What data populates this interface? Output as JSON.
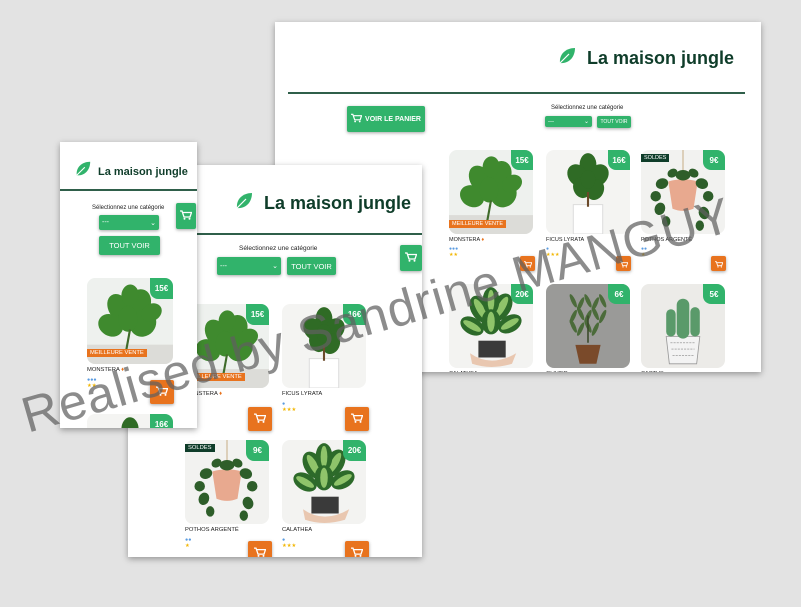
{
  "app": {
    "title": "La maison jungle"
  },
  "colors": {
    "green": "#31b36b",
    "dark_green": "#0f3d2a",
    "orange": "#e8731e",
    "background": "#e3e3e3"
  },
  "icons": {
    "logo": "leaf-icon",
    "cart": "cart-icon",
    "water": "water-drop-icon",
    "sun": "sun-icon",
    "fire": "fire-icon"
  },
  "filters": {
    "category_label": "Sélectionnez une catégorie",
    "select_value": "---",
    "show_all": "TOUT VOIR"
  },
  "cart_button_label": "VOIR LE PANIER",
  "labels": {
    "best_seller": "MEILLEURE VENTE",
    "sale": "SOLDES"
  },
  "plants": [
    {
      "name": "MONSTERA",
      "price": "15€",
      "water": 3,
      "light": 2,
      "best": true,
      "sale": false
    },
    {
      "name": "FICUS LYRATA",
      "price": "16€",
      "water": 1,
      "light": 3,
      "best": false,
      "sale": false
    },
    {
      "name": "POTHOS ARGENTÉ",
      "price": "9€",
      "water": 2,
      "light": 1,
      "best": false,
      "sale": true
    },
    {
      "name": "CALATHEA",
      "price": "20€",
      "water": 1,
      "light": 3,
      "best": false,
      "sale": false
    },
    {
      "name": "OLIVIER",
      "price": "6€",
      "water": 1,
      "light": 3,
      "best": false,
      "sale": false
    },
    {
      "name": "CACTUS",
      "price": "5€",
      "water": 1,
      "light": 3,
      "best": false,
      "sale": false
    }
  ],
  "watermark": "Realised by Sandrine MANGUY"
}
